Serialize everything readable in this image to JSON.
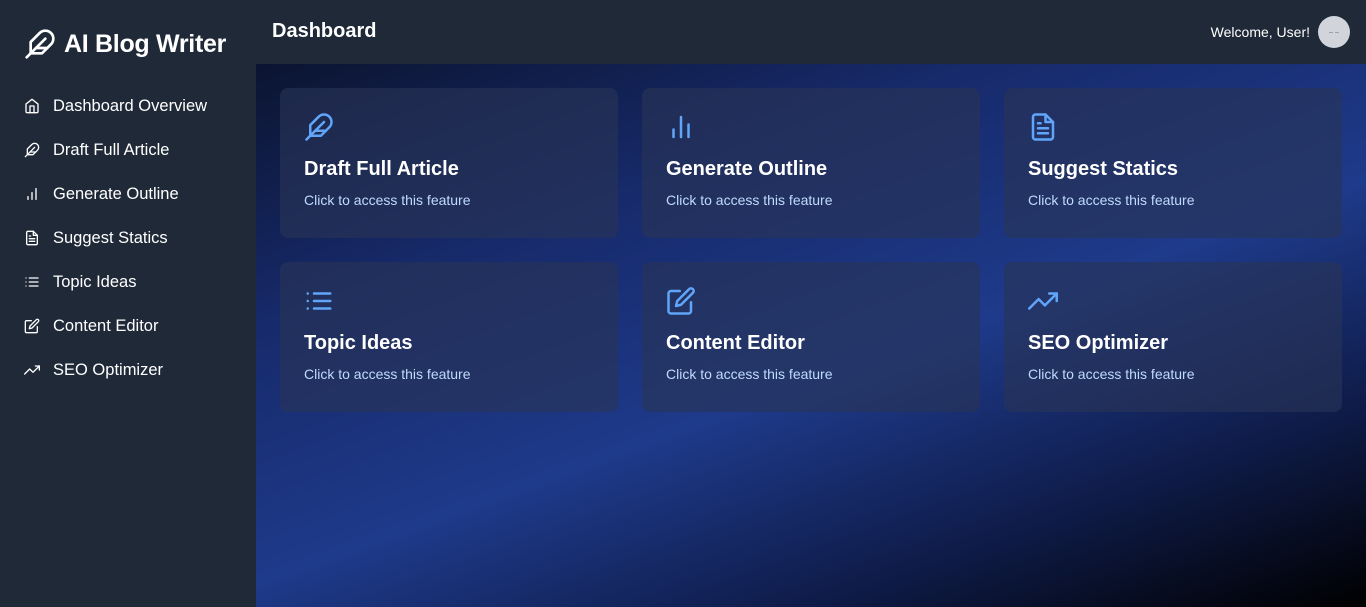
{
  "app": {
    "title": "AI Blog Writer"
  },
  "sidebar": {
    "items": [
      {
        "label": "Dashboard Overview",
        "icon": "home-icon"
      },
      {
        "label": "Draft Full Article",
        "icon": "feather-icon"
      },
      {
        "label": "Generate Outline",
        "icon": "bar-chart-icon"
      },
      {
        "label": "Suggest Statics",
        "icon": "file-text-icon"
      },
      {
        "label": "Topic Ideas",
        "icon": "list-icon"
      },
      {
        "label": "Content Editor",
        "icon": "edit-icon"
      },
      {
        "label": "SEO Optimizer",
        "icon": "trending-up-icon"
      }
    ]
  },
  "header": {
    "title": "Dashboard",
    "welcome": "Welcome, User!"
  },
  "cards": [
    {
      "title": "Draft Full Article",
      "subtitle": "Click to access this feature",
      "icon": "feather-icon"
    },
    {
      "title": "Generate Outline",
      "subtitle": "Click to access this feature",
      "icon": "bar-chart-icon"
    },
    {
      "title": "Suggest Statics",
      "subtitle": "Click to access this feature",
      "icon": "file-text-icon"
    },
    {
      "title": "Topic Ideas",
      "subtitle": "Click to access this feature",
      "icon": "list-icon"
    },
    {
      "title": "Content Editor",
      "subtitle": "Click to access this feature",
      "icon": "edit-icon"
    },
    {
      "title": "SEO Optimizer",
      "subtitle": "Click to access this feature",
      "icon": "trending-up-icon"
    }
  ],
  "colors": {
    "accent": "#60a5fa",
    "sidebar_bg": "#1f2937",
    "card_subtitle": "#bfdbfe"
  }
}
